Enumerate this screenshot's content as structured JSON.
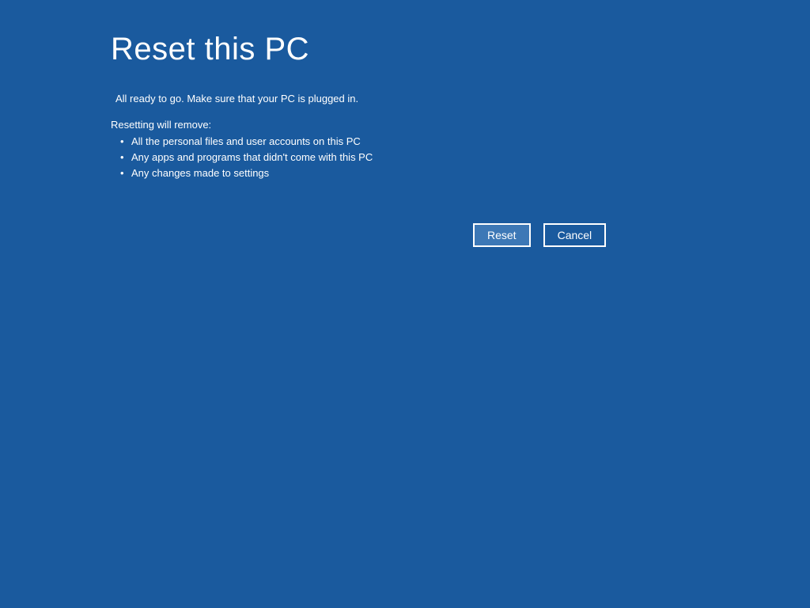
{
  "header": {
    "title": "Reset this PC"
  },
  "content": {
    "status": "All ready to go. Make sure that your PC is plugged in.",
    "list_heading": "Resetting will remove:",
    "items": [
      "All the personal files and user accounts on this PC",
      "Any apps and programs that didn't come with this PC",
      "Any changes made to settings"
    ]
  },
  "buttons": {
    "reset_label": "Reset",
    "cancel_label": "Cancel"
  }
}
